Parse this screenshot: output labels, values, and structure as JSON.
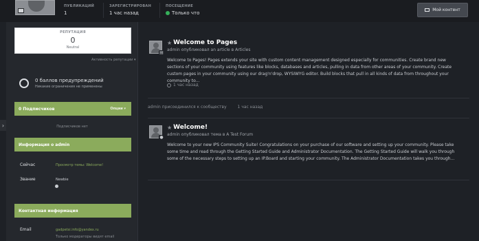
{
  "header": {
    "stats": [
      {
        "label": "ПУБЛИКАЦИЙ",
        "value": "1"
      },
      {
        "label": "ЗАРЕГИСТРИРОВАН",
        "value": "1 час назад"
      },
      {
        "label": "ПОСЕЩЕНИЕ",
        "value": "Только что"
      }
    ],
    "my_content_label": "Мой контент"
  },
  "sidebar": {
    "reputation": {
      "label": "РЕПУТАЦИЯ",
      "value": "0",
      "level": "Neutral"
    },
    "reputation_link": "Активность репутации",
    "warnings": {
      "title": "0 баллов предупреждений",
      "subtitle": "Никакие ограничения не применены"
    },
    "subscribers": {
      "header": "0 Подписчиков",
      "options_label": "Опции",
      "empty_text": "Подписчиков нет"
    },
    "about": {
      "header": "Информация о admin",
      "rows": [
        {
          "label": "Сейчас",
          "value": "Просмотр темы: Welcome!"
        },
        {
          "label": "Звание",
          "value": "Newbie"
        }
      ]
    },
    "contact": {
      "header": "Контактная информация",
      "email_label": "Email",
      "email_value": "gadpetsi.info@yandex.ru",
      "email_note": "Только модераторы видят email"
    }
  },
  "feed": {
    "posts": [
      {
        "title": "Welcome to Pages",
        "meta": "admin опубликовал an article в Articles",
        "body": "Welcome to Pages! Pages extends your site with custom content management designed especially for communities. Create brand new sections of your community using features like blocks, databases and articles, pulling in data from other areas of your community. Create custom pages in your community using our drag'n'drop, WYSIWYG editor. Build blocks that pull in all kinds of data from throughout your community to...",
        "time": "1 час назад"
      },
      {
        "title": "Welcome!",
        "meta": "admin опубликовал тема в A Test Forum",
        "body": "Welcome to your new IPS Community Suite! Congratulations on your purchase of our software and setting up your community. Please take some time and read through the Getting Started Guide and Administrator Documentation. The Getting Started Guide will walk you through some of the necessary steps to setting up an IP.Board and starting your community. The Administrator Documentation takes you through...",
        "time": ""
      }
    ],
    "activity": {
      "text": "admin присоединился к сообществу",
      "time": "1 час назад"
    }
  }
}
